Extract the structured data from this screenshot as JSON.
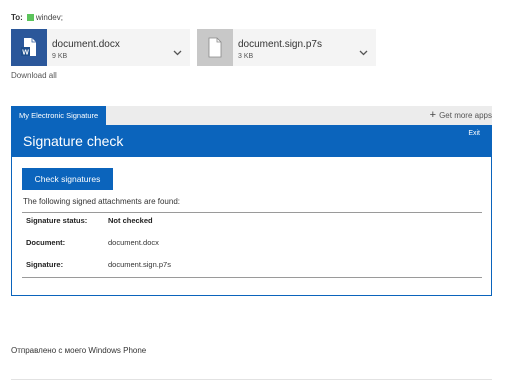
{
  "to": {
    "label": "To:",
    "recipient": "windev;"
  },
  "attachments": [
    {
      "name": "document.docx",
      "size": "9 KB",
      "icon": "word-document-icon"
    },
    {
      "name": "document.sign.p7s",
      "size": "3 KB",
      "icon": "generic-file-icon"
    }
  ],
  "download_all": "Download all",
  "addin": {
    "tab_label": "My Electronic Signature",
    "get_more": "Get more apps",
    "title": "Signature check",
    "exit": "Exit",
    "button": "Check signatures",
    "found_text": "The following signed attachments are found:",
    "rows": [
      {
        "key": "Signature status:",
        "value": "Not checked"
      },
      {
        "key": "Document:",
        "value": "document.docx"
      },
      {
        "key": "Signature:",
        "value": "document.sign.p7s"
      }
    ]
  },
  "footer": {
    "signature": "Отправлено с моего Windows Phone"
  },
  "colors": {
    "accent": "#0b64bc",
    "word": "#2b579a",
    "presence": "#5cc45c"
  }
}
